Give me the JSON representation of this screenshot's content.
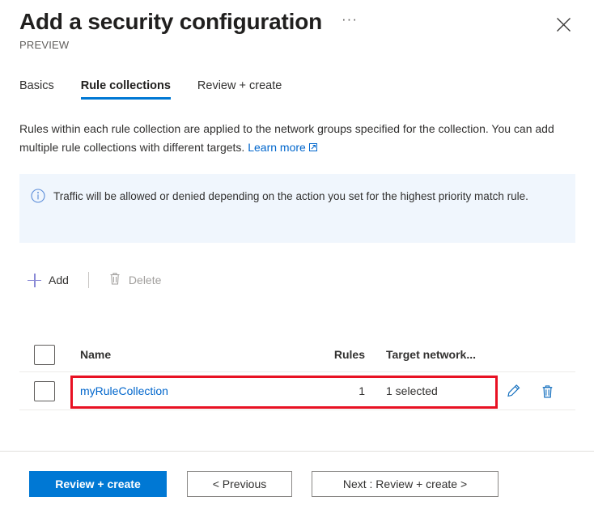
{
  "header": {
    "title": "Add a security configuration",
    "preview_label": "PREVIEW",
    "ellipsis_label": "···",
    "close_icon": "close-icon"
  },
  "tabs": [
    {
      "label": "Basics",
      "active": false
    },
    {
      "label": "Rule collections",
      "active": true
    },
    {
      "label": "Review + create",
      "active": false
    }
  ],
  "description": {
    "text": "Rules within each rule collection are applied to the network groups specified for the collection. You can add multiple rule collections with different targets.",
    "link_label": "Learn more",
    "link_icon": "external-link-icon"
  },
  "info_banner": {
    "icon": "info-circle-icon",
    "text": "Traffic will be allowed or denied depending on the action you set for the highest priority match rule.",
    "background": "#f0f6fd"
  },
  "commandbar": {
    "add_label": "Add",
    "add_icon": "plus-icon",
    "delete_label": "Delete",
    "delete_icon": "trash-icon",
    "delete_disabled": true
  },
  "table": {
    "columns": [
      "Name",
      "Rules",
      "Target network..."
    ],
    "rows": [
      {
        "name": "myRuleCollection",
        "rules": "1",
        "target": "1 selected",
        "edit_icon": "pencil-icon",
        "delete_icon": "trash-icon"
      }
    ]
  },
  "annotation": {
    "highlight_color": "#e81123"
  },
  "footer": {
    "primary_label": "Review + create",
    "previous_label": "< Previous",
    "next_label": "Next : Review + create >"
  },
  "colors": {
    "accent": "#0078d4",
    "link": "#0066cc",
    "highlight": "#e81123"
  }
}
